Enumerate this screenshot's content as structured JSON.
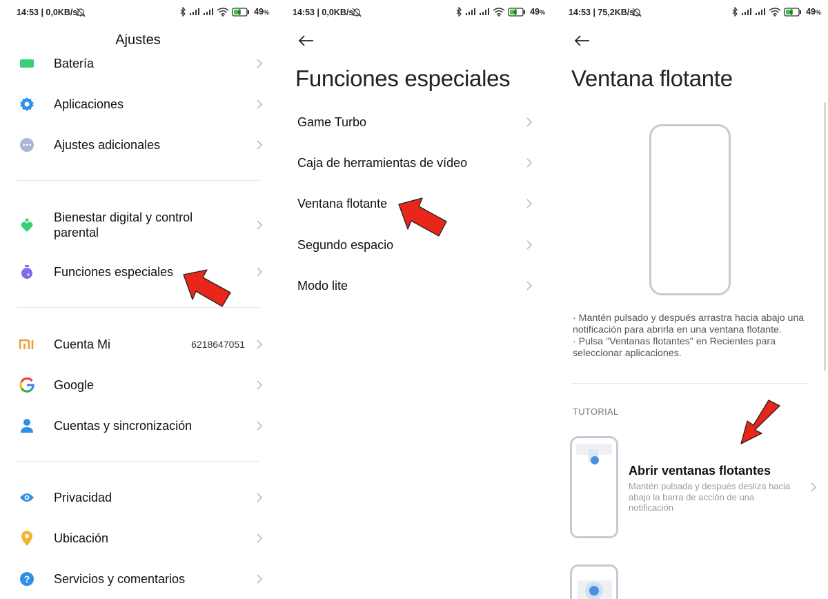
{
  "status_bars": [
    {
      "time": "14:53 | 0,0KB/s",
      "battery": "49"
    },
    {
      "time": "14:53 | 0,0KB/s",
      "battery": "49"
    },
    {
      "time": "14:53 | 75,2KB/s",
      "battery": "49"
    }
  ],
  "status_icons": [
    "mute-bell-icon",
    "bluetooth-icon",
    "signal-icon",
    "signal-icon",
    "wifi-icon",
    "battery-icon"
  ],
  "battery_percent_symbol": "%",
  "screen1": {
    "title": "Ajustes",
    "items": [
      {
        "label": "Batería",
        "icon": "battery-icon",
        "color": "#3ccf7a"
      },
      {
        "label": "Aplicaciones",
        "icon": "gear-icon",
        "color": "#2f8ee6"
      },
      {
        "label": "Ajustes adicionales",
        "icon": "more-dots-icon",
        "color": "#a9b6d9"
      },
      {
        "label": "Bienestar digital y control parental",
        "icon": "heart-person-icon",
        "color": "#3ccf7a"
      },
      {
        "label": "Funciones especiales",
        "icon": "potion-icon",
        "color": "#7b6ee8"
      },
      {
        "label": "Cuenta Mi",
        "icon": "mi-logo-icon",
        "color": "#f29a33",
        "value": "6218647051"
      },
      {
        "label": "Google",
        "icon": "google-g-icon",
        "color": "#4285f4"
      },
      {
        "label": "Cuentas y sincronización",
        "icon": "person-icon",
        "color": "#2f8ee6"
      },
      {
        "label": "Privacidad",
        "icon": "eye-icon",
        "color": "#2f8ee6"
      },
      {
        "label": "Ubicación",
        "icon": "location-pin-icon",
        "color": "#f5b331"
      },
      {
        "label": "Servicios y comentarios",
        "icon": "help-icon",
        "color": "#2f8ee6"
      }
    ]
  },
  "screen2": {
    "title": "Funciones especiales",
    "items": [
      {
        "label": "Game Turbo"
      },
      {
        "label": "Caja de herramientas de vídeo"
      },
      {
        "label": "Ventana flotante"
      },
      {
        "label": "Segundo espacio"
      },
      {
        "label": "Modo lite"
      }
    ]
  },
  "screen3": {
    "title": "Ventana flotante",
    "description": [
      "· Mantén pulsado y después arrastra hacia abajo una notificación para abrirla en una ventana flotante.",
      "· Pulsa \"Ventanas flotantes\" en Recientes para seleccionar aplicaciones."
    ],
    "section_label": "TUTORIAL",
    "tutorial": {
      "title": "Abrir ventanas flotantes",
      "description": "Mantén pulsada y después desliza hacia abajo la barra de acción de una notificación"
    }
  },
  "colors": {
    "annotation_arrow": "#e8261a",
    "illustration_border": "#c6cad6",
    "accent_blue": "#4a90e2"
  }
}
